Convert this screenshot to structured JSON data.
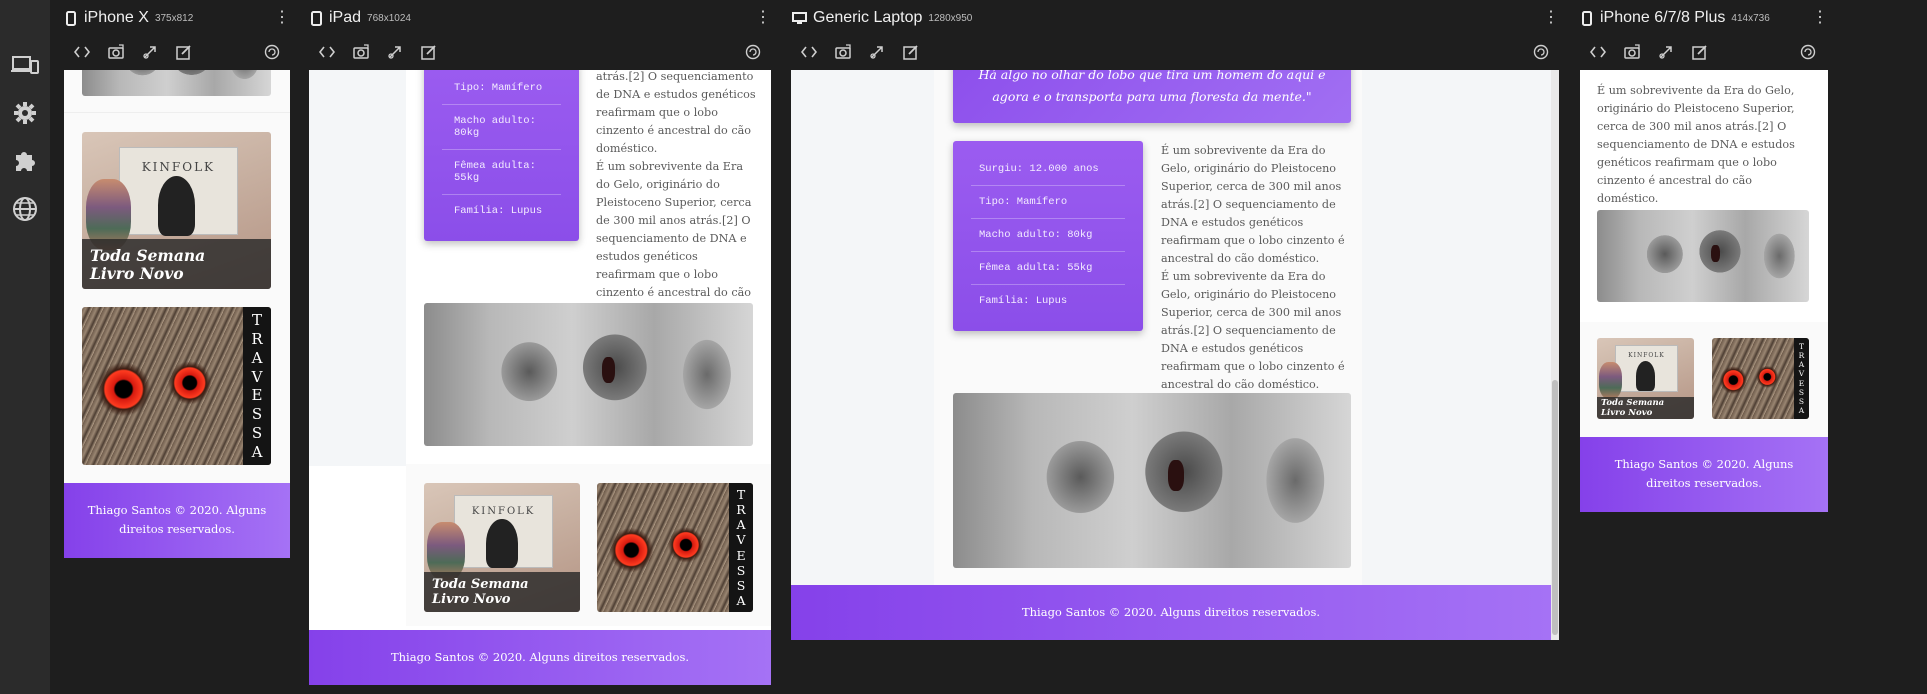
{
  "sidebar": {
    "icons": [
      "devices-icon",
      "gear-icon",
      "puzzle-icon",
      "globe-icon"
    ]
  },
  "devices": [
    {
      "name": "iPhone X",
      "size": "375x812"
    },
    {
      "name": "iPad",
      "size": "768x1024"
    },
    {
      "name": "Generic Laptop",
      "size": "1280x950"
    },
    {
      "name": "iPhone 6/7/8 Plus",
      "size": "414x736"
    }
  ],
  "device_tools": [
    "code-icon",
    "screenshot-icon",
    "sync-icon",
    "edit-icon",
    "rotate-icon"
  ],
  "page": {
    "info_rows": [
      "Surgiu: 12.000 anos",
      "Tipo: Mamífero",
      "Macho adulto: 80kg",
      "Fêmea adulta: 55kg",
      "Família: Lupus"
    ],
    "ipad_info_rows": [
      "Tipo: Mamífero",
      "Macho adulto: 80kg",
      "Fêmea adulta: 55kg",
      "Família: Lupus"
    ],
    "quote_line1": "Há algo no olhar do lobo que tira um homem do aqui e",
    "quote_line2": "agora e o transporta para uma floresta da mente.\"",
    "paragraph": "É um sobrevivente da Era do Gelo, originário do Pleistoceno Superior, cerca de 300 mil anos atrás.[2] O sequenciamento de DNA e estudos genéticos reafirmam que o lobo cinzento é ancestral do cão doméstico.",
    "ipad_fragment": "atrás.[2] O sequenciamento de DNA e estudos genéticos reafirmam que o lobo cinzento é ancestral do cão doméstico.",
    "book_title": "KINFOLK",
    "caption_line1": "Toda Semana",
    "caption_line2": "Livro Novo",
    "travessa_letters": [
      "T",
      "R",
      "A",
      "V",
      "E",
      "S",
      "S",
      "A"
    ],
    "footer": "Thiago Santos © 2020. Alguns direitos reservados.",
    "footer_line1": "Thiago Santos © 2020. Alguns",
    "footer_line2": "direitos reservados."
  },
  "colors": {
    "accent": "#8b4ee9",
    "accent_light": "#a572f5",
    "frame_bg": "#1e1e1e"
  }
}
